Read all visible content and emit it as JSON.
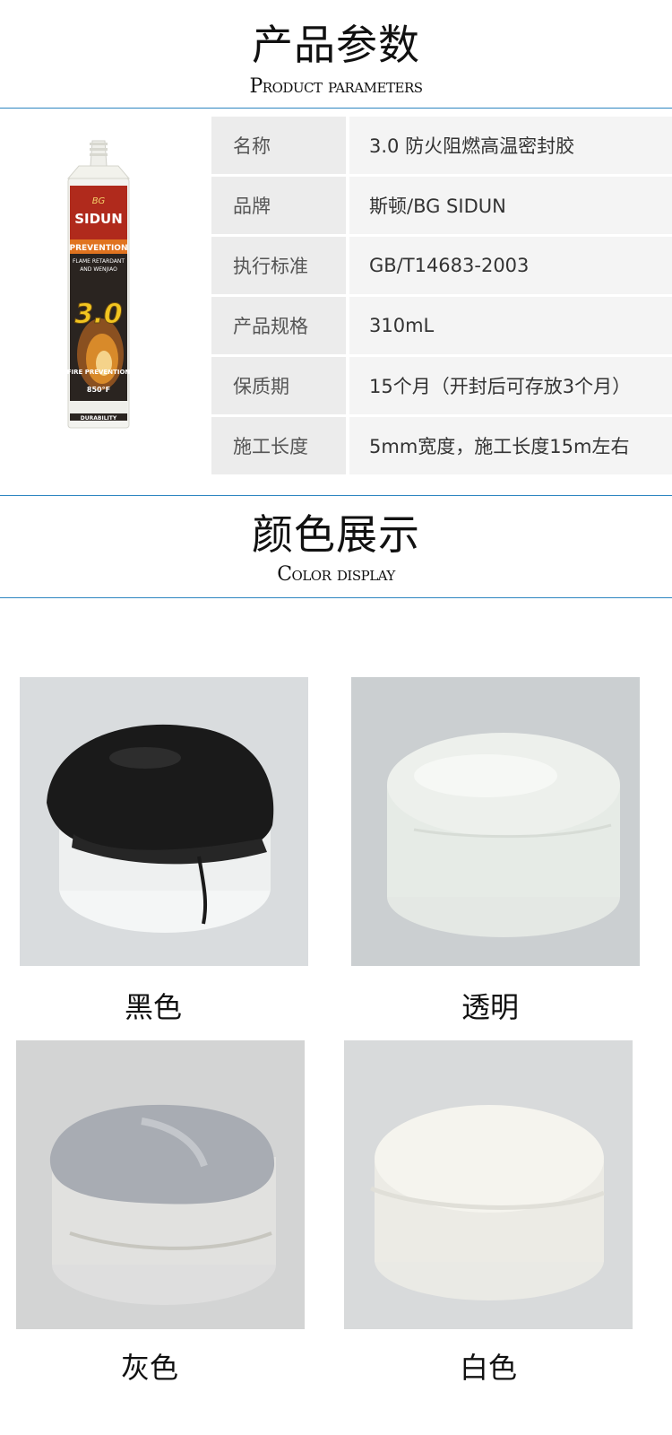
{
  "params_section": {
    "title_cn": "产品参数",
    "title_en": "Product parameters"
  },
  "product_tube": {
    "brand_small": "BG",
    "brand": "SIDUN",
    "line1": "PREVENTION",
    "line2": "FLAME RETARDANT",
    "line3": "AND WENJIAO",
    "version": "3.0",
    "fire": "FIRE PREVENTION",
    "temp": "850°F",
    "bottom": "DURABILITY"
  },
  "params": [
    {
      "key": "名称",
      "value": "3.0 防火阻燃高温密封胶"
    },
    {
      "key": "品牌",
      "value": "斯顿/BG SIDUN"
    },
    {
      "key": "执行标准",
      "value": "GB/T14683-2003"
    },
    {
      "key": "产品规格",
      "value": "310mL"
    },
    {
      "key": "保质期",
      "value": "15个月（开封后可存放3个月）"
    },
    {
      "key": "施工长度",
      "value": "5mm宽度，施工长度15m左右"
    }
  ],
  "colors_section": {
    "title_cn": "颜色展示",
    "title_en": "Color display"
  },
  "swatches": [
    {
      "label": "黑色",
      "color": "#1a1a1a"
    },
    {
      "label": "透明",
      "color": "#e6ebe6"
    },
    {
      "label": "灰色",
      "color": "#a8acb3"
    },
    {
      "label": "白色",
      "color": "#f3f1ea"
    }
  ],
  "theme": {
    "divider": "#2e86c1",
    "key_bg": "#ececec",
    "value_bg": "#f4f4f4"
  }
}
